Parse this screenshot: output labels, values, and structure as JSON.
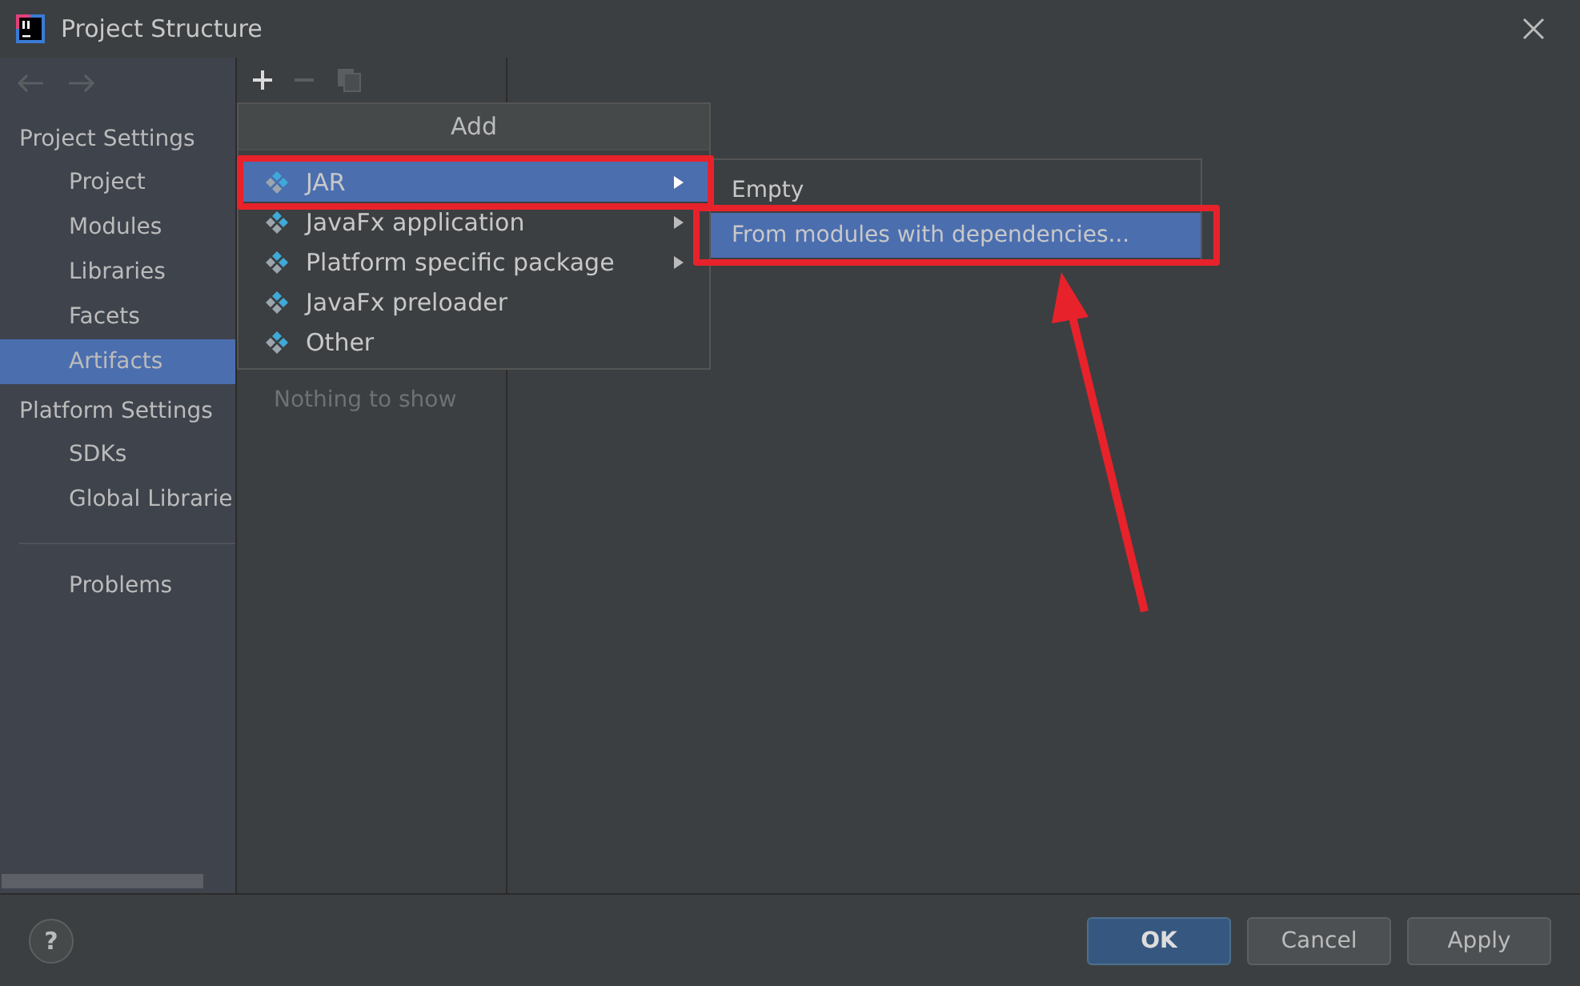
{
  "window": {
    "title": "Project Structure"
  },
  "sidebar": {
    "sections": [
      {
        "heading": "Project Settings",
        "items": [
          {
            "label": "Project",
            "selected": false
          },
          {
            "label": "Modules",
            "selected": false
          },
          {
            "label": "Libraries",
            "selected": false
          },
          {
            "label": "Facets",
            "selected": false
          },
          {
            "label": "Artifacts",
            "selected": true
          }
        ]
      },
      {
        "heading": "Platform Settings",
        "items": [
          {
            "label": "SDKs",
            "selected": false
          },
          {
            "label": "Global Librarie",
            "selected": false
          }
        ]
      },
      {
        "items": [
          {
            "label": "Problems",
            "selected": false
          }
        ]
      }
    ]
  },
  "artifacts_panel": {
    "empty_text": "Nothing to show"
  },
  "add_menu": {
    "title": "Add",
    "items": [
      {
        "label": "JAR",
        "selected": true,
        "submenu": true
      },
      {
        "label": "JavaFx application",
        "selected": false,
        "submenu": true
      },
      {
        "label": "Platform specific package",
        "selected": false,
        "submenu": true
      },
      {
        "label": "JavaFx preloader",
        "selected": false,
        "submenu": false
      },
      {
        "label": "Other",
        "selected": false,
        "submenu": false
      }
    ]
  },
  "submenu": {
    "items": [
      {
        "label": "Empty",
        "selected": false
      },
      {
        "label": "From modules with dependencies...",
        "selected": true
      }
    ]
  },
  "help": {
    "label": "?"
  },
  "buttons": [
    {
      "label": "OK",
      "kind": "primary"
    },
    {
      "label": "Cancel",
      "kind": "normal"
    },
    {
      "label": "Apply",
      "kind": "normal"
    }
  ]
}
